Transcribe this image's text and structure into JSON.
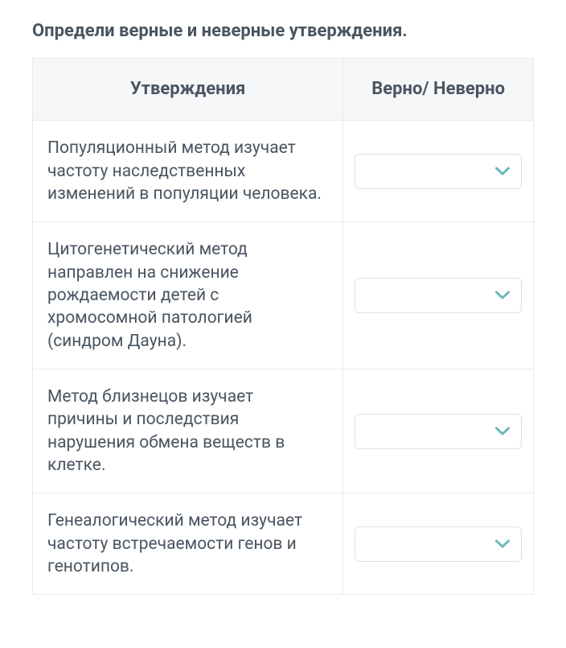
{
  "instruction": "Определи верные и неверные утверждения.",
  "table": {
    "headers": {
      "statements": "Утверждения",
      "answer": "Верно/ Неверно"
    },
    "rows": [
      {
        "statement": "Популяционный метод изучает частоту наследственных изменений в популяции человека.",
        "selected": ""
      },
      {
        "statement": "Цитогенетический метод направлен на снижение рождаемости детей с хромосомной патологией (синдром Дауна).",
        "selected": ""
      },
      {
        "statement": "Метод близнецов изучает причины и последствия нарушения обмена веществ в клетке.",
        "selected": ""
      },
      {
        "statement": "Генеалогический метод изучает частоту встречаемости генов и генотипов.",
        "selected": ""
      }
    ]
  },
  "colors": {
    "text": "#4a5561",
    "border": "#e6e9ed",
    "header_bg": "#f5f7f9",
    "chevron": "#6fb8bd",
    "dropdown_border": "#d8e3e4"
  }
}
